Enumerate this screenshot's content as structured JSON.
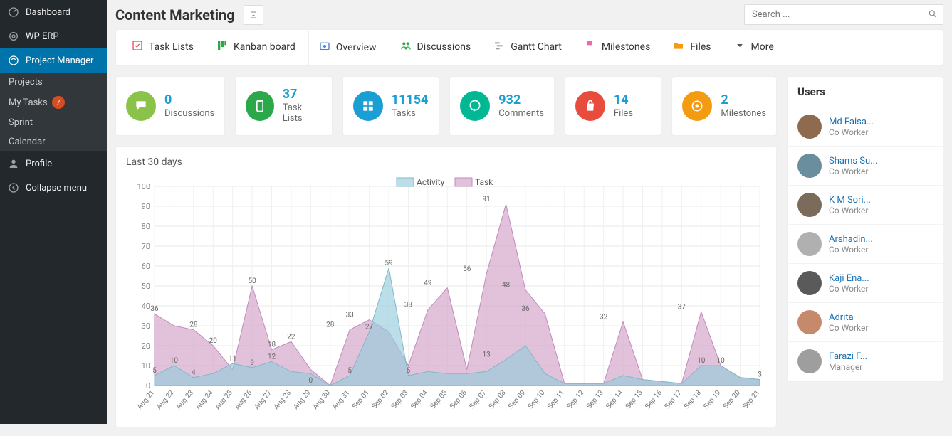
{
  "sidebar": {
    "items": [
      {
        "label": "Dashboard",
        "icon": "gauge"
      },
      {
        "label": "WP ERP",
        "icon": "gear-ring"
      },
      {
        "label": "Project Manager",
        "icon": "pm",
        "active": true
      },
      {
        "label": "Profile",
        "icon": "user"
      },
      {
        "label": "Collapse menu",
        "icon": "collapse"
      }
    ],
    "subitems": [
      {
        "label": "Projects"
      },
      {
        "label": "My Tasks",
        "badge": "7"
      },
      {
        "label": "Sprint"
      },
      {
        "label": "Calendar"
      }
    ]
  },
  "header": {
    "title": "Content Marketing",
    "search_placeholder": "Search ..."
  },
  "tabs": [
    {
      "label": "Task Lists",
      "color": "#e94b5b",
      "icon": "check-square"
    },
    {
      "label": "Kanban board",
      "color": "#2ba84a",
      "icon": "kanban"
    },
    {
      "label": "Overview",
      "color": "#4a7bd0",
      "icon": "overview",
      "active": true
    },
    {
      "label": "Discussions",
      "color": "#2ba84a",
      "icon": "discuss"
    },
    {
      "label": "Gantt Chart",
      "color": "#9aa0a6",
      "icon": "gantt"
    },
    {
      "label": "Milestones",
      "color": "#e86aa6",
      "icon": "flag"
    },
    {
      "label": "Files",
      "color": "#f39c12",
      "icon": "folder"
    },
    {
      "label": "More",
      "color": "#555555",
      "icon": "caret"
    }
  ],
  "stats": [
    {
      "value": "0",
      "label": "Discussions",
      "color": "#8bc34a",
      "icon": "chat"
    },
    {
      "value": "37",
      "label": "Task Lists",
      "color": "#2ba84a",
      "icon": "clipboard"
    },
    {
      "value": "11154",
      "label": "Tasks",
      "color": "#1a9ed4",
      "icon": "grid"
    },
    {
      "value": "932",
      "label": "Comments",
      "color": "#00b894",
      "icon": "comment"
    },
    {
      "value": "14",
      "label": "Files",
      "color": "#e74c3c",
      "icon": "bag"
    },
    {
      "value": "2",
      "label": "Milestones",
      "color": "#f39c12",
      "icon": "target"
    }
  ],
  "chart_data": {
    "type": "area",
    "title": "Last 30 days",
    "ylabel": "",
    "xlabel": "",
    "ylim": [
      0,
      100
    ],
    "yticks": [
      0,
      10,
      20,
      30,
      40,
      50,
      60,
      70,
      80,
      90,
      100
    ],
    "legend": [
      "Activity",
      "Task"
    ],
    "categories": [
      "Aug 21",
      "Aug 22",
      "Aug 23",
      "Aug 24",
      "Aug 25",
      "Aug 26",
      "Aug 27",
      "Aug 28",
      "Aug 29",
      "Aug 30",
      "Aug 31",
      "Sep 01",
      "Sep 02",
      "Sep 03",
      "Sep 04",
      "Sep 05",
      "Sep 06",
      "Sep 07",
      "Sep 08",
      "Sep 09",
      "Sep 10",
      "Sep 11",
      "Sep 12",
      "Sep 13",
      "Sep 14",
      "Sep 15",
      "Sep 16",
      "Sep 17",
      "Sep 18",
      "Sep 19",
      "Sep 20",
      "Sep 21"
    ],
    "series": [
      {
        "name": "Activity",
        "color": "rgba(150,205,220,0.65)",
        "stroke": "#7fb9c9",
        "values": [
          5,
          10,
          4,
          6,
          11,
          9,
          12,
          7,
          6,
          0,
          5,
          27,
          59,
          5,
          7,
          6,
          6,
          7,
          13,
          20,
          6,
          1,
          1,
          1,
          5,
          3,
          2,
          1,
          10,
          10,
          4,
          3
        ]
      },
      {
        "name": "Task",
        "color": "rgba(210,160,200,0.65)",
        "stroke": "#c18abb",
        "values": [
          36,
          30,
          28,
          20,
          8,
          50,
          18,
          22,
          8,
          0,
          28,
          33,
          27,
          10,
          38,
          49,
          8,
          56,
          91,
          48,
          36,
          1,
          1,
          1,
          32,
          3,
          2,
          1,
          37,
          10,
          4,
          3
        ]
      }
    ],
    "point_labels": {
      "Task": {
        "Aug 21": 36,
        "Aug 23": 28,
        "Aug 24": 20,
        "Aug 26": 50,
        "Aug 27": 18,
        "Aug 28": 22,
        "Aug 30": 28,
        "Aug 31": 33,
        "Sep 01": 27,
        "Sep 03": 38,
        "Sep 04": 49,
        "Sep 06": 56,
        "Sep 07": 91,
        "Sep 08": 48,
        "Sep 09": 36,
        "Sep 13": 32,
        "Sep 17": 37
      },
      "Activity": {
        "Aug 21": 5,
        "Aug 22": 10,
        "Aug 23": 4,
        "Aug 25": 11,
        "Aug 26": 9,
        "Aug 27": 12,
        "Aug 29": 0,
        "Aug 31": 5,
        "Sep 02": 59,
        "Sep 03": 5,
        "Sep 07": 13,
        "Sep 18": 10,
        "Sep 19": 10,
        "Sep 21": 3
      }
    }
  },
  "users_panel": {
    "title": "Users",
    "list": [
      {
        "name": "Md Faisa...",
        "role": "Co Worker",
        "color": "#8e6b4e"
      },
      {
        "name": "Shams Su...",
        "role": "Co Worker",
        "color": "#6b8e9e"
      },
      {
        "name": "K M Sori...",
        "role": "Co Worker",
        "color": "#7a6b5a"
      },
      {
        "name": "Arshadin...",
        "role": "Co Worker",
        "color": "#b0b0b0"
      },
      {
        "name": "Kaji Ena...",
        "role": "Co Worker",
        "color": "#5a5a5a"
      },
      {
        "name": "Adrita",
        "role": "Co Worker",
        "color": "#c48a6b"
      },
      {
        "name": "Farazi F...",
        "role": "Manager",
        "color": "#9e9e9e"
      }
    ]
  }
}
